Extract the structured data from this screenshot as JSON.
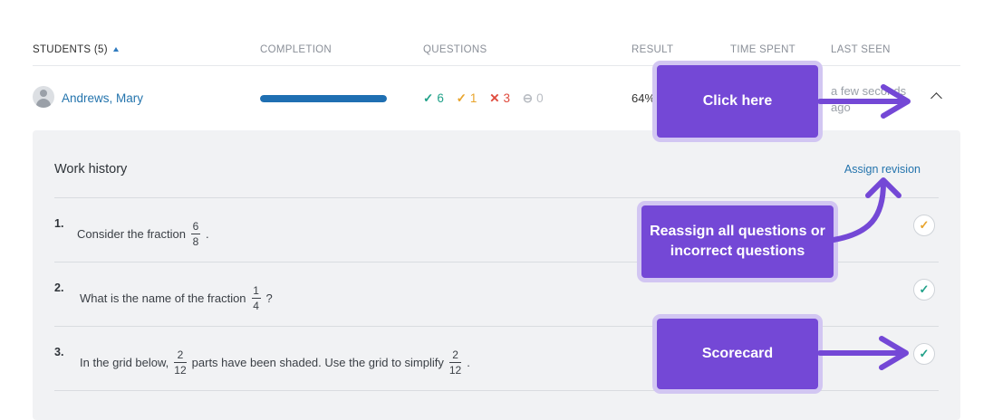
{
  "table": {
    "headers": {
      "students": "STUDENTS (5)",
      "completion": "COMPLETION",
      "questions": "QUESTIONS",
      "result": "RESULT",
      "time_spent": "TIME SPENT",
      "last_seen": "LAST SEEN"
    },
    "student": {
      "name": "Andrews, Mary",
      "completion_percent": 100,
      "correct": "6",
      "partial": "1",
      "incorrect": "3",
      "skipped": "0",
      "result": "64%",
      "last_seen": "a few seconds ago"
    }
  },
  "work_history": {
    "title": "Work history",
    "assign_label": "Assign revision",
    "questions": [
      {
        "num": "1.",
        "pre": "Consider the fraction",
        "frac_num": "6",
        "frac_den": "8",
        "post": "."
      },
      {
        "num": "2.",
        "pre": "What is the name of the fraction",
        "frac_num": "1",
        "frac_den": "4",
        "post": "?"
      },
      {
        "num": "3.",
        "pre": "In the grid below,",
        "frac_num": "2",
        "frac_den": "12",
        "mid": "parts have been shaded. Use the grid to simplify",
        "frac2_num": "2",
        "frac2_den": "12",
        "post": "."
      }
    ]
  },
  "callouts": {
    "click_here": "Click here",
    "reassign": "Reassign all questions or incorrect questions",
    "scorecard": "Scorecard"
  },
  "colors": {
    "accent": "#7448d6",
    "link": "#2474ad",
    "correct": "#21a189",
    "partial": "#e8a42c",
    "incorrect": "#df4a3c"
  }
}
